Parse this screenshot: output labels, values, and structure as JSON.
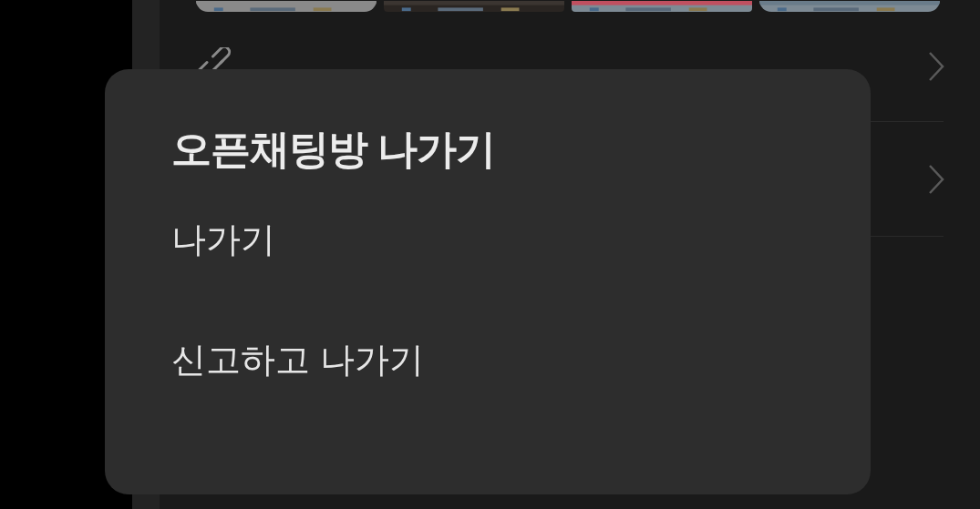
{
  "background": {
    "rows": [
      {
        "kind": "link"
      },
      {
        "kind": "plain"
      }
    ]
  },
  "dialog": {
    "title": "오픈채팅방 나가기",
    "options": [
      "나가기",
      "신고하고 나가기"
    ]
  }
}
